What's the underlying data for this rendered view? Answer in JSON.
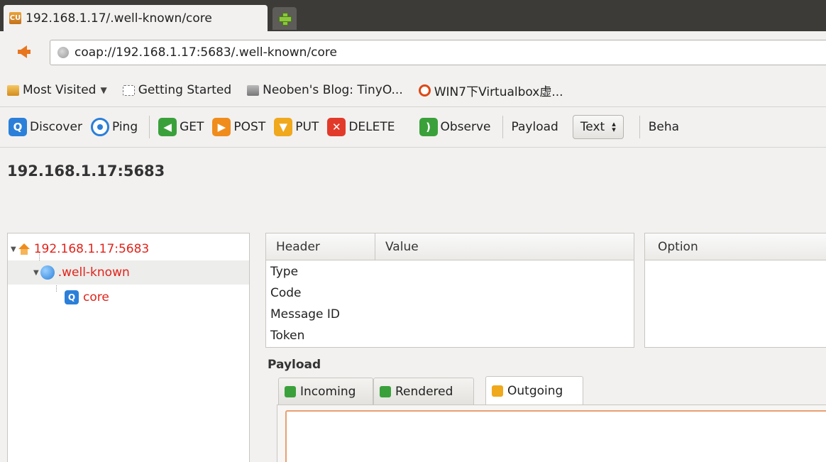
{
  "window": {
    "tab_title": "192.168.1.17/.well-known/core",
    "favicon_text": "CU"
  },
  "navigation": {
    "url": "coap://192.168.1.17:5683/.well-known/core"
  },
  "bookmarks": [
    {
      "label": "Most Visited",
      "icon": "folder-icon",
      "has_dropdown": true
    },
    {
      "label": "Getting Started",
      "icon": "page-icon"
    },
    {
      "label": "Neoben's Blog: TinyO...",
      "icon": "person-icon"
    },
    {
      "label": "WIN7下Virtualbox虚...",
      "icon": "ubuntu-icon"
    }
  ],
  "toolbar": {
    "discover": "Discover",
    "ping": "Ping",
    "get": "GET",
    "post": "POST",
    "put": "PUT",
    "delete": "DELETE",
    "observe": "Observe",
    "payload_label": "Payload",
    "payload_select": "Text",
    "behavior_label": "Beha"
  },
  "main": {
    "host_title": "192.168.1.17:5683"
  },
  "tree": {
    "root": "192.168.1.17:5683",
    "child": ".well-known",
    "leaf": "core"
  },
  "headers_table": {
    "columns": [
      "Header",
      "Value"
    ],
    "rows": [
      "Type",
      "Code",
      "Message ID",
      "Token"
    ]
  },
  "options_table": {
    "columns": [
      "Option"
    ]
  },
  "payload": {
    "label": "Payload",
    "tabs": [
      "Incoming",
      "Rendered",
      "Outgoing"
    ],
    "active_tab": "Outgoing"
  },
  "colors": {
    "tree_text": "#e2231a",
    "accent_blue": "#2b7fd9",
    "accent_green": "#3aa13a",
    "accent_orange": "#f08c1c",
    "delete_red": "#e23a2a"
  }
}
